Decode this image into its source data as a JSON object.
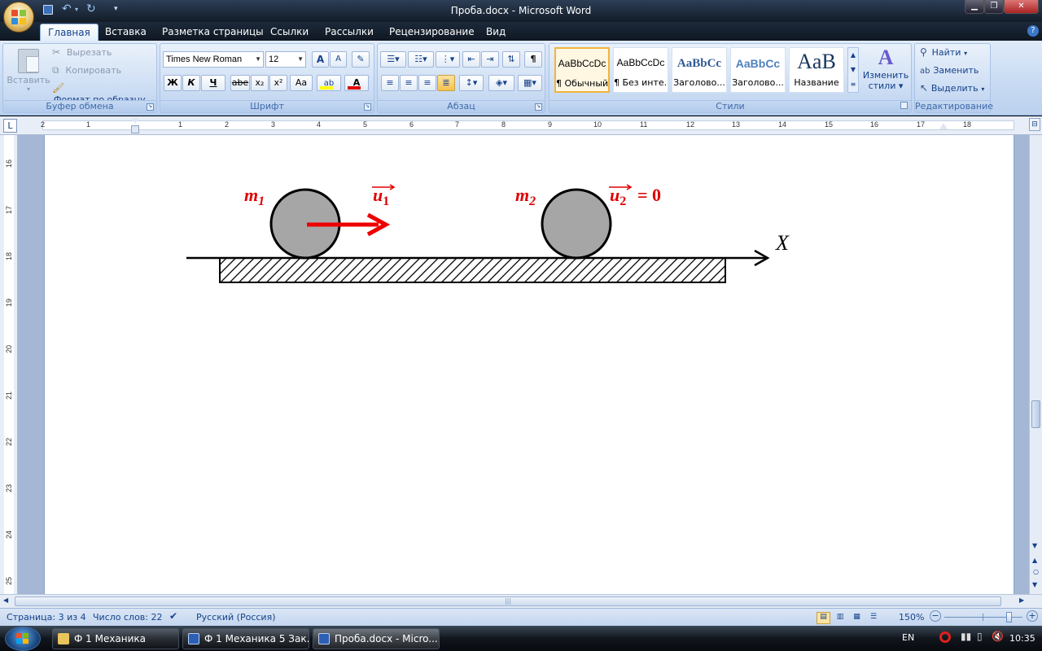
{
  "window": {
    "title": "Проба.docx - Microsoft Word",
    "minimize_icon": "minimize-icon",
    "maximize_icon": "restore-icon",
    "close_icon": "close-icon"
  },
  "quick_access": {
    "save": "save-icon",
    "undo": "undo-icon",
    "redo": "redo-icon",
    "customize": "▾"
  },
  "tabs": [
    "Главная",
    "Вставка",
    "Разметка страницы",
    "Ссылки",
    "Рассылки",
    "Рецензирование",
    "Вид"
  ],
  "help_icon": "?",
  "clipboard": {
    "label": "Буфер обмена",
    "paste": "Вставить",
    "cut": "Вырезать",
    "copy": "Копировать",
    "format_painter": "Формат по образцу"
  },
  "font": {
    "label": "Шрифт",
    "family": "Times New Roman",
    "size": "12",
    "grow": "A",
    "shrink": "A",
    "bold": "Ж",
    "italic": "К",
    "underline": "Ч",
    "strike": "abe",
    "subscript": "x₂",
    "superscript": "x²",
    "case": "Aa",
    "highlight": "ab",
    "color": "A",
    "highlight_color": "#ffff00",
    "font_color": "#e00000"
  },
  "paragraph": {
    "label": "Абзац",
    "pilcrow": "¶"
  },
  "styles": {
    "label": "Стили",
    "items": [
      {
        "preview": "AaBbCcDc",
        "name": "¶ Обычный"
      },
      {
        "preview": "AaBbCcDc",
        "name": "¶ Без инте..."
      },
      {
        "preview": "AaBbCc",
        "name": "Заголово..."
      },
      {
        "preview": "AaBbCc",
        "name": "Заголово..."
      },
      {
        "preview": "AaB",
        "name": "Название"
      }
    ],
    "change_styles_line1": "Изменить",
    "change_styles_line2": "стили"
  },
  "editing": {
    "label": "Редактирование",
    "find": "Найти",
    "replace": "Заменить",
    "select": "Выделить"
  },
  "ruler": {
    "h_ticks": [
      "2",
      "1",
      "1",
      "2",
      "3",
      "4",
      "5",
      "6",
      "7",
      "8",
      "9",
      "10",
      "11",
      "12",
      "13",
      "14",
      "15",
      "16",
      "17",
      "18"
    ],
    "v_ticks": [
      "16",
      "17",
      "18",
      "19",
      "20",
      "21",
      "22",
      "23",
      "24",
      "25"
    ]
  },
  "figure": {
    "m1_label": "m",
    "m1_sub": "1",
    "m2_label": "m",
    "m2_sub": "2",
    "u1_label": "u",
    "u1_sub": "1",
    "u2_label": "u",
    "u2_sub": "2",
    "u2_rhs": "= 0",
    "axis_label": "X",
    "label_color": "#e00000",
    "arrow_color": "#ee0000",
    "ball_fill": "#a6a6a6"
  },
  "status": {
    "page": "Страница: 3 из 4",
    "words": "Число слов: 22",
    "language": "Русский (Россия)",
    "zoom": "150%",
    "zoom_minus": "−",
    "zoom_plus": "+",
    "zoom_level": 0.82
  },
  "taskbar": {
    "items": [
      {
        "label": "Ф 1 Механика",
        "icon": "folder-icon"
      },
      {
        "label": "Ф 1 Механика 5 Зак...",
        "icon": "word-doc-icon"
      },
      {
        "label": "Проба.docx - Micro...",
        "icon": "word-doc-icon"
      }
    ],
    "lang": "EN",
    "clock": "10:35"
  }
}
